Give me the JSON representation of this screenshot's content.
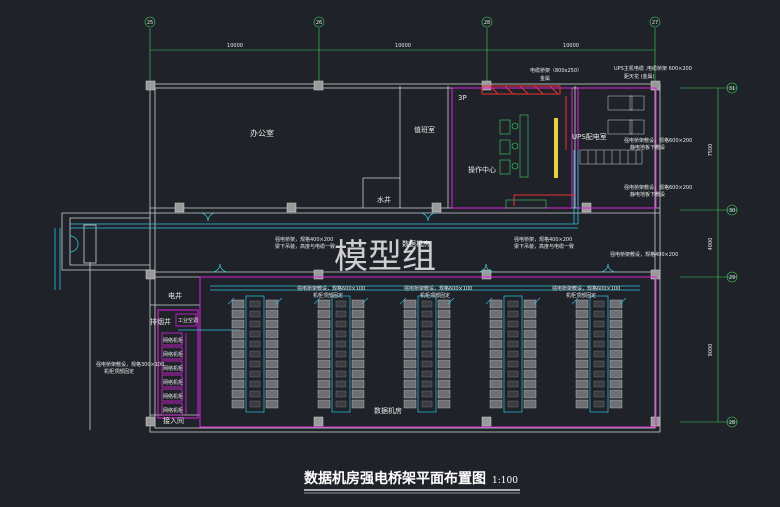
{
  "drawing": {
    "title": "数据机房强电桥架平面布置图",
    "scale": "1:100",
    "watermark": "模型组"
  },
  "grid": {
    "columns": [
      "25",
      "26",
      "28",
      "27"
    ],
    "rows": [
      "31",
      "30",
      "29",
      "28"
    ],
    "col_dims": [
      "10000",
      "10000",
      "10000"
    ],
    "row_dims": [
      "7500",
      "4000",
      "9000"
    ]
  },
  "rooms": {
    "office": "办公室",
    "duty_room": "值班室",
    "water_well": "水井",
    "ops_center": "操作中心",
    "ups_room": "UPS配电室",
    "corridor_label": "数据机房",
    "elec_well": "电井",
    "cable_room": "排烟井",
    "access_room": "接入间",
    "data_room": "数据机房",
    "3p": "3P"
  },
  "annotations": {
    "tray_top": "电缆桥架（800x250）",
    "tray_top_sub": "金属",
    "ups_top_1": "UPS主机电缆 ,电缆桥架 600×200",
    "ups_top_2": "距天花 (金属)",
    "corridor_1": "强电桥架，规格400×200",
    "corridor_1_sub": "梁下吊装，高度与电缆一致",
    "corridor_2": "强电桥架，规格400×200",
    "corridor_2_sub": "梁下吊装，高度与电缆一致",
    "ups_right_1": "强电桥架敷设，规格600×200",
    "ups_right_1_sub": "静电地板下敷设",
    "ups_right_2": "强电桥架敷设，规格600×200",
    "ups_right_2_sub": "静电地板下敷设",
    "right_corridor": "强电桥架敷设，规格400×200",
    "row_1": "强电桥架敷设，规格600×100",
    "row_1_sub": "机柜顶部固定",
    "row_2": "强电桥架敷设，规格600×100",
    "row_2_sub": "机柜顶部固定",
    "row_3": "强电桥架敷设，规格600×100",
    "row_3_sub": "机柜顶部固定",
    "left_1": "强电桥架敷设，规格300×100",
    "left_1_sub": "机柜顶部固定",
    "panel_label": "工业空调",
    "access_cab": "网络机柜"
  }
}
